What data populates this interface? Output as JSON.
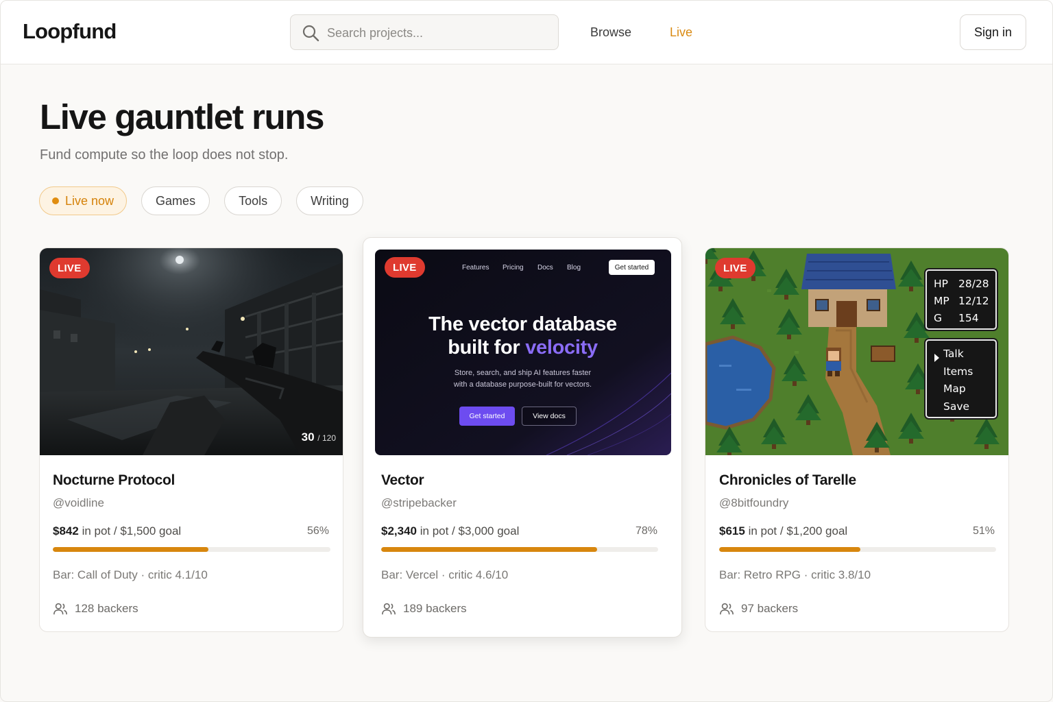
{
  "header": {
    "logo": "Loopfund",
    "search_placeholder": "Search projects...",
    "nav": {
      "browse": "Browse",
      "live": "Live"
    },
    "sign_in": "Sign in"
  },
  "hero": {
    "title": "Live gauntlet runs",
    "subtitle": "Fund compute so the loop does not stop."
  },
  "filters": [
    {
      "label": "Live now",
      "active": true
    },
    {
      "label": "Games",
      "active": false
    },
    {
      "label": "Tools",
      "active": false
    },
    {
      "label": "Writing",
      "active": false
    }
  ],
  "colors": {
    "accent": "#d8870e",
    "live_badge": "#df3a2f",
    "vector_accent": "#8a6cf6"
  },
  "cards": [
    {
      "badge": "LIVE",
      "title": "Nocturne Protocol",
      "handle": "@voidline",
      "pot": "$842",
      "pot_suffix": "in pot / $1,500 goal",
      "percent_label": "56%",
      "progress": 0.56,
      "meta": "Bar: Call of Duty · critic 4.1/10",
      "backers": "128 backers",
      "thumb": {
        "ammo": "30",
        "ammo_total": "/ 120"
      }
    },
    {
      "badge": "LIVE",
      "title": "Vector",
      "handle": "@stripebacker",
      "pot": "$2,340",
      "pot_suffix": "in pot / $3,000 goal",
      "percent_label": "78%",
      "progress": 0.78,
      "meta": "Bar: Vercel · critic 4.6/10",
      "backers": "189 backers",
      "thumb": {
        "nav": [
          "Features",
          "Pricing",
          "Docs",
          "Blog"
        ],
        "cta": "Get started",
        "headline_1": "The vector database",
        "headline_2a": "built for ",
        "headline_2b": "velocity",
        "body_1": "Store, search, and ship AI features faster",
        "body_2": "with a database purpose-built for vectors.",
        "primary_btn": "Get started",
        "secondary_btn": "View docs"
      }
    },
    {
      "badge": "LIVE",
      "title": "Chronicles of Tarelle",
      "handle": "@8bitfoundry",
      "pot": "$615",
      "pot_suffix": "in pot / $1,200 goal",
      "percent_label": "51%",
      "progress": 0.51,
      "meta": "Bar: Retro RPG · critic 3.8/10",
      "backers": "97 backers",
      "thumb": {
        "stats": [
          {
            "label": "HP",
            "value": "28/28"
          },
          {
            "label": "MP",
            "value": "12/12"
          },
          {
            "label": "G",
            "value": "154"
          }
        ],
        "menu": [
          "Talk",
          "Items",
          "Map",
          "Save"
        ]
      }
    }
  ]
}
